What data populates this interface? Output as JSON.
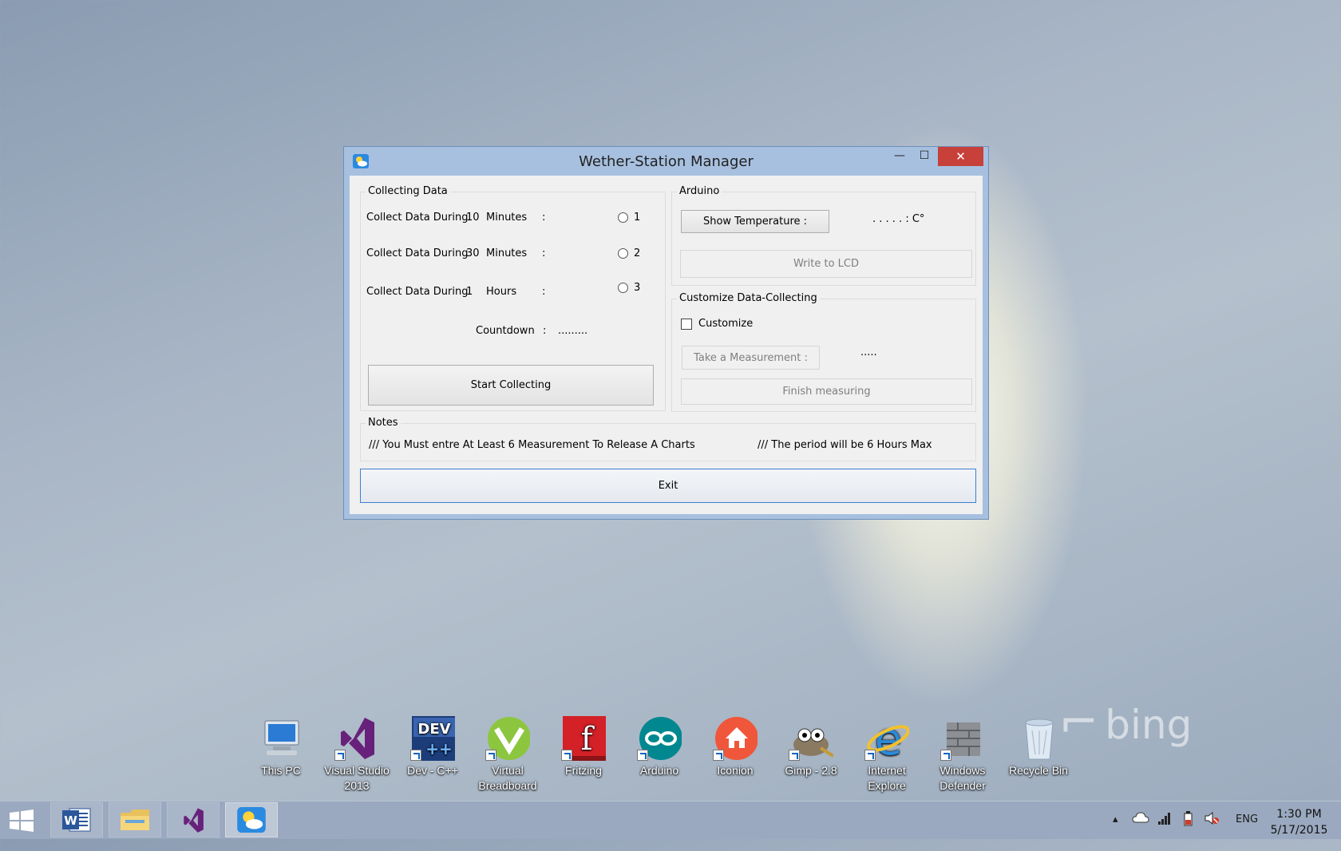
{
  "window": {
    "title": "Wether-Station Manager",
    "minimize": "—",
    "maximize": "☐",
    "close": "✕"
  },
  "collecting": {
    "legend": "Collecting Data",
    "rows": [
      {
        "label": "Collect Data During",
        "amount": "10",
        "unit": "Minutes",
        "colon": ":",
        "radio_label": "1"
      },
      {
        "label": "Collect Data During",
        "amount": "30",
        "unit": "Minutes",
        "colon": ":",
        "radio_label": "2"
      },
      {
        "label": "Collect Data During",
        "amount": "1",
        "unit": "Hours",
        "colon": ":",
        "radio_label": "3"
      }
    ],
    "countdown_label": "Countdown",
    "countdown_colon": ":",
    "countdown_value": ".........",
    "start_button": "Start Collecting"
  },
  "arduino": {
    "legend": "Arduino",
    "show_temp_button": "Show Temperature :",
    "temp_value": ". . . . . :  C°",
    "write_lcd_button": "Write to LCD"
  },
  "customize": {
    "legend": "Customize Data-Collecting",
    "checkbox_label": "Customize",
    "take_measurement_button": "Take a Measurement  :",
    "measurement_value": ".....",
    "finish_button": "Finish measuring"
  },
  "notes": {
    "legend": "Notes",
    "note1": "/// You Must entre At Least 6 Measurement  To Release A Charts",
    "note2": "/// The period will be 6 Hours Max"
  },
  "exit_button": "Exit",
  "desktop_icons": [
    {
      "label": "This PC",
      "icon": "computer-icon"
    },
    {
      "label": "Visual Studio 2013",
      "icon": "visual-studio-icon"
    },
    {
      "label": "Dev - C++",
      "icon": "dev-cpp-icon"
    },
    {
      "label": "Virtual Breadboard",
      "icon": "virtual-breadboard-icon"
    },
    {
      "label": "Fritzing",
      "icon": "fritzing-icon"
    },
    {
      "label": "Arduino",
      "icon": "arduino-icon"
    },
    {
      "label": "Iconion",
      "icon": "iconion-icon"
    },
    {
      "label": "Gimp - 2.8",
      "icon": "gimp-icon"
    },
    {
      "label": "Internet Explore",
      "icon": "internet-explorer-icon"
    },
    {
      "label": "Windows Defender",
      "icon": "windows-defender-icon"
    },
    {
      "label": "Recycle Bin",
      "icon": "recycle-bin-icon"
    }
  ],
  "wallpaper_brand": "bing",
  "taskbar": {
    "apps": [
      "word-icon",
      "file-explorer-icon",
      "visual-studio-icon",
      "weather-app-icon"
    ],
    "language": "ENG",
    "time": "1:30 PM",
    "date": "5/17/2015"
  },
  "colors": {
    "window_border": "#a7c0df",
    "close_button": "#c7403a",
    "taskbar": "#9aa9bf",
    "focus_border": "#3c7fd0"
  }
}
